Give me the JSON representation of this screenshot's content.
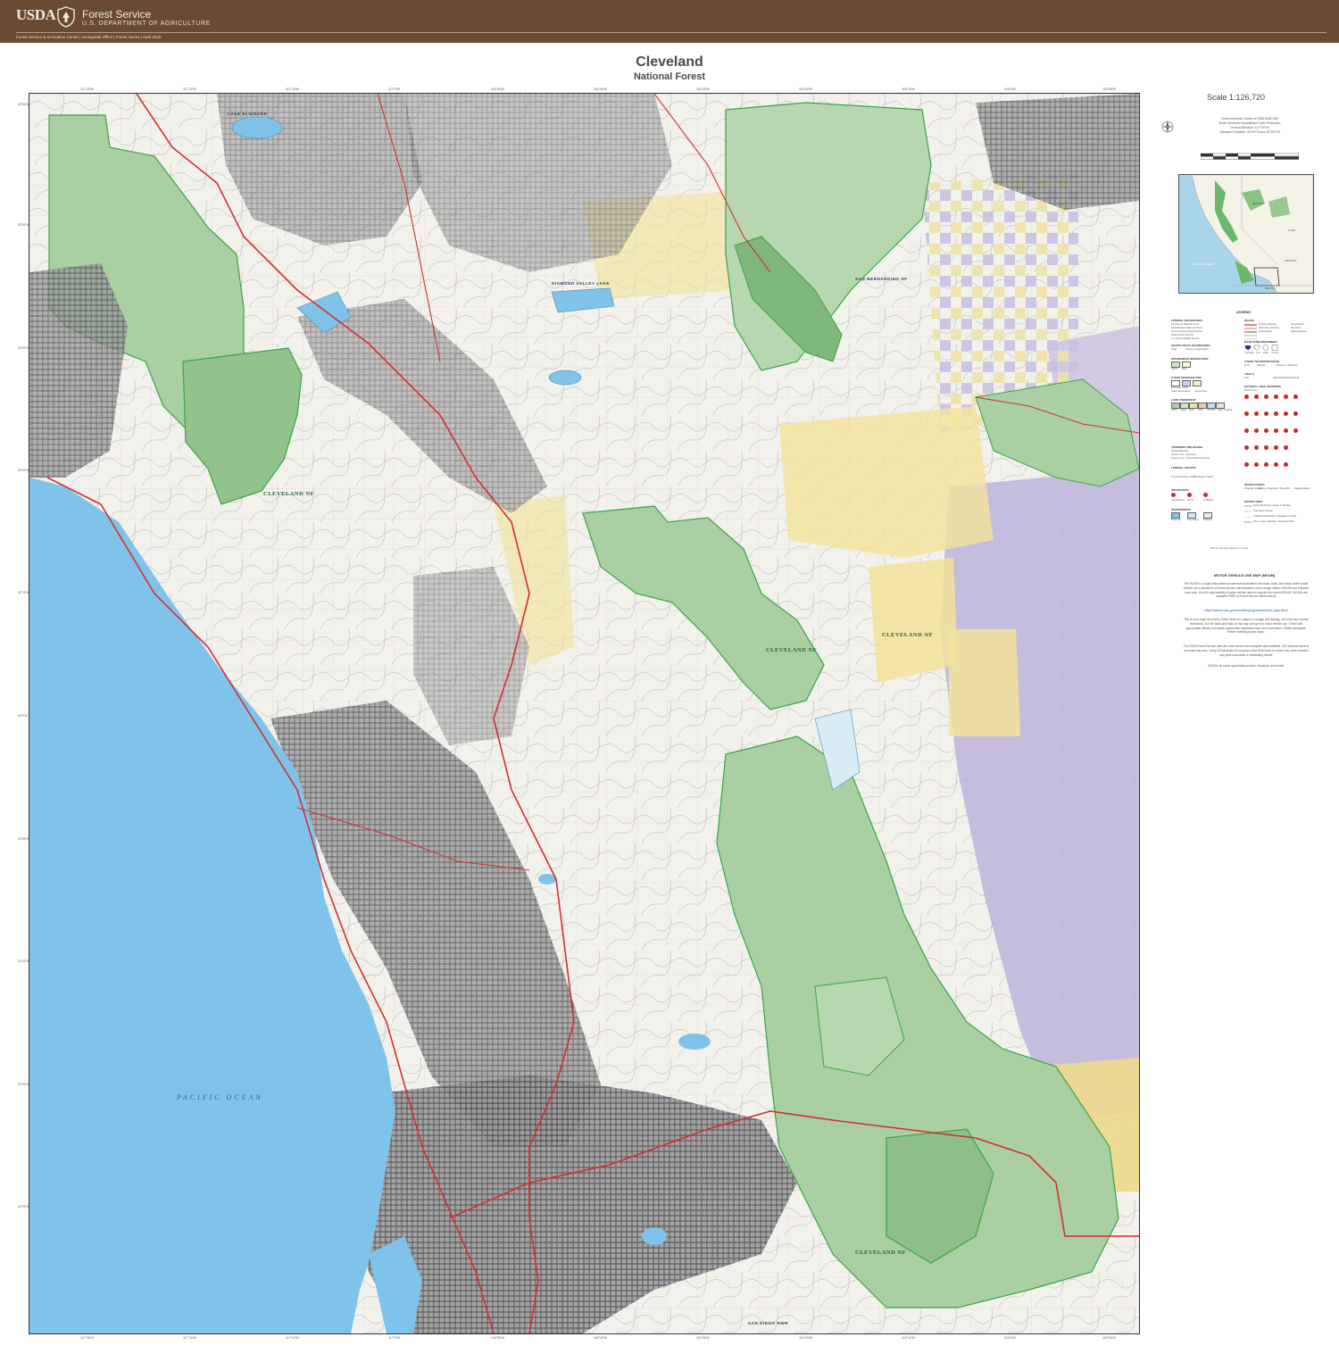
{
  "header": {
    "usda": "USDA",
    "agency": "Forest Service",
    "department": "U.S. DEPARTMENT OF AGRICULTURE",
    "credits": "Forest Service & Innovation Center | Geospatial Office | Forest Series | April 2020"
  },
  "title": "Cleveland",
  "subtitle": "National Forest",
  "map": {
    "ocean_label": "PACIFIC OCEAN",
    "forest_labels": [
      "CLEVELAND NF",
      "CLEVELAND NF",
      "CLEVELAND NF",
      "CLEVELAND NF"
    ],
    "place_labels": [
      "LAKE ELSINORE",
      "DIAMOND VALLEY LAKE",
      "SAN BERNARDINO NF",
      "SAN DIEGO NWR"
    ],
    "top_ticks": [
      "117°30'W",
      "117°20'W",
      "117°10'W",
      "117°0'W",
      "116°50'W",
      "116°40'W",
      "116°30'W",
      "116°20'W",
      "116°10'W",
      "116°0'W",
      "115°50'W"
    ],
    "bottom_ticks": [
      "117°30'W",
      "117°20'W",
      "117°10'W",
      "117°0'W",
      "116°50'W",
      "116°40'W",
      "116°30'W",
      "116°20'W",
      "116°10'W",
      "116°0'W",
      "115°50'W"
    ],
    "left_ticks": [
      "33°50'N",
      "33°40'N",
      "33°30'N",
      "33°20'N",
      "33°10'N",
      "33°0'N",
      "32°50'N",
      "32°40'N",
      "32°30'N",
      "32°20'N"
    ],
    "colors": {
      "ocean": "#7fc3ea",
      "forest": "#a9cfa2",
      "forest_boundary": "#3aa447",
      "blm": "#f2e39a",
      "tribal": "#b9b0d8",
      "urban": "#6e6e70",
      "highway": "#d32f2f",
      "terrain": "#f2f1ec"
    }
  },
  "scale": "Scale 1:126,720",
  "datum": [
    "North American Datum of 1983 (NAD 83)",
    "North American Equidistant Conic Projection",
    "Central Meridian: 117°0'0\"W",
    "Standard Parallels: 32°0'0\"N and 33°30'0\"N"
  ],
  "inset": {
    "ocean": "PACIFIC OCEAN",
    "country": "MEXICO",
    "states": [
      "NEVADA",
      "UTAH",
      "ARIZONA"
    ]
  },
  "legend": {
    "title": "LEGEND",
    "sections": [
      {
        "heading": "FEDERAL BOUNDARIES",
        "items": [
          "Proclaimed National Forest",
          "Administrative National Forest",
          "Forest Service Ranger District",
          "National Park Service",
          "U.S. Fish & Wildlife Service"
        ]
      },
      {
        "heading": "GEOPOLITICAL BOUNDARIES",
        "items": [
          "State",
          "County (or Equivalent)"
        ]
      },
      {
        "heading": "WILDERNESS DESIGNATION",
        "items": [
          "USFS",
          "BLM"
        ]
      },
      {
        "heading": "OTHER DESIGNATIONS",
        "items": [
          "Recreation Area",
          "Indian Reservation",
          "Scenic Area"
        ]
      },
      {
        "heading": "LAND OWNERSHIP",
        "items": [
          "USFS",
          "USFS",
          "BLM",
          "NPS",
          "USFWS",
          "Other Federal"
        ]
      },
      {
        "heading": "TOWNSHIP AND RANGE",
        "items": [
          "Township/Range",
          "Section Line - Surveyed",
          "Section Line - Protracted/Unsurveyed"
        ]
      },
      {
        "heading": "FEDERAL OFFICES",
        "items": [
          "FS Administrative Office",
          "FS Ranger Station"
        ]
      },
      {
        "heading": "RECREATION",
        "items": [
          "Campground",
          "Picnic",
          "Trailhead"
        ]
      },
      {
        "heading": "WATERBODIES",
        "items": [
          "Perennial",
          "Intermittent",
          "Wetland"
        ]
      }
    ],
    "right_sections": [
      {
        "heading": "ROADS",
        "items": [
          "Primary Highway",
          "Secondary Highway",
          "Forest Road",
          "Gravel Road",
          "Dirt Road",
          "High Clearance"
        ]
      },
      {
        "heading": "ROAD SHIELDS/NUMBER",
        "items": [
          "Interstate",
          "U.S.",
          "State",
          "County"
        ]
      },
      {
        "heading": "OTHER TRANSPORTATION",
        "items": [
          "Ferry",
          "Railroad",
          "Runway or Backstrip"
        ]
      },
      {
        "heading": "TRAILS",
        "items": [
          "Trail",
          "National Designated Trail"
        ]
      },
      {
        "heading": "NATIONAL TRAIL MARKERS",
        "items": [
          "Pacific Crest"
        ]
      },
      {
        "heading": "WATER POINTS",
        "items": [
          "Waterfall / Rapids",
          "Spring / Seep",
          "Ditch / Flow",
          "Well",
          "Staging Station"
        ]
      },
      {
        "heading": "WATER LINES",
        "items": [
          "Perennial Stream, Canal, or Pipeline",
          "Intermittent Stream",
          "Underground Pipeline / Aqueduct / Tunnel",
          "Dam, Levee, Chamber / Monsoon Bank"
        ]
      }
    ],
    "note": "*Not all symbols appear on map."
  },
  "mvum": {
    "title": "MOTOR VEHICLE USE MAP (MVUM)",
    "paragraphs": [
      "The MVUM is a legal enforceable document that identifies the roads, trails, and areas where motor vehicle use is allowed in a Forest Service administrative unit or ranger district. MVUMs are released each year. It is the responsibility of motor vehicle users to acquire the current MVUM. MVUMs are available FREE at Forest Service offices and at:",
      "https://www.fs.usda.gov/recreation/programs/ohv/ohv_maps.shtml",
      "This is not a legal document. Public lands are subject to change and leasing, and may have access restrictions. Not all roads and trails on this map are open to motor vehicle use. Check with appropriate officials and obtain appropriate regulatory maps and information. Obtain permission before entering private lands.",
      "The USDA Forest Service uses the most current and complete data available. GIS data and product accuracy may vary. Using GIS products for purposes other than those for which they were intended may yield inaccurate or misleading results.",
      "USDA is an equal opportunity provider, employer, and lender."
    ]
  }
}
